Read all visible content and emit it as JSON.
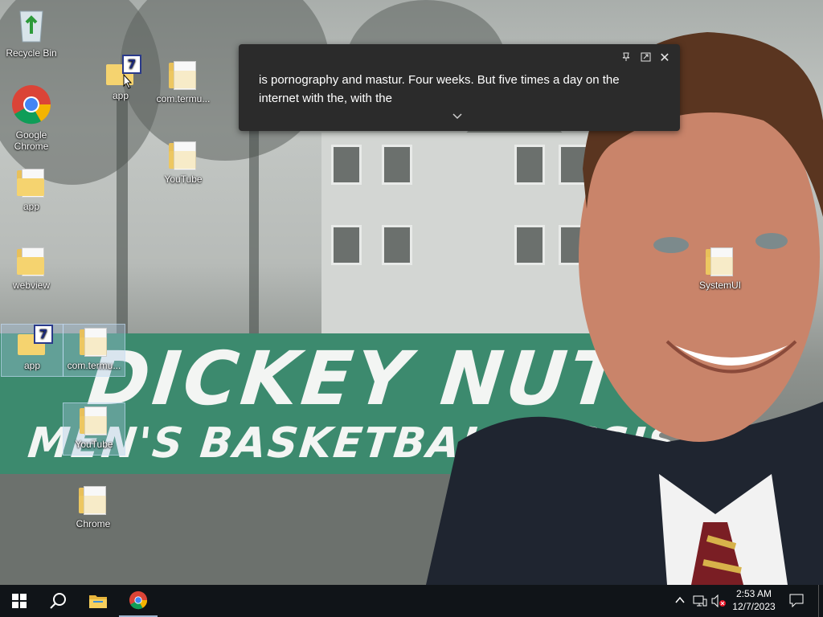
{
  "desktop": {
    "icons": [
      {
        "label": "Recycle Bin"
      },
      {
        "label": "Google Chrome"
      },
      {
        "label": "app"
      },
      {
        "label": "webview"
      },
      {
        "label": "app"
      },
      {
        "label": "app"
      },
      {
        "label": "com.termu..."
      },
      {
        "label": "YouTube"
      },
      {
        "label": "com.termu..."
      },
      {
        "label": "YouTube"
      },
      {
        "label": "Chrome"
      },
      {
        "label": "SystemUI"
      }
    ]
  },
  "wallpaper": {
    "line1": "DICKEY NUTT",
    "line2": "MEN'S BASKETBALL ASSISTANT"
  },
  "caption_window": {
    "text": "is pornography and mastur. Four weeks. But five times a day on the internet with the, with the"
  },
  "taskbar": {
    "time": "2:53 AM",
    "date": "12/7/2023"
  },
  "colors": {
    "banner": "#3c8a6e",
    "taskbar": "#101418",
    "caption_bg": "#2b2b2b"
  }
}
